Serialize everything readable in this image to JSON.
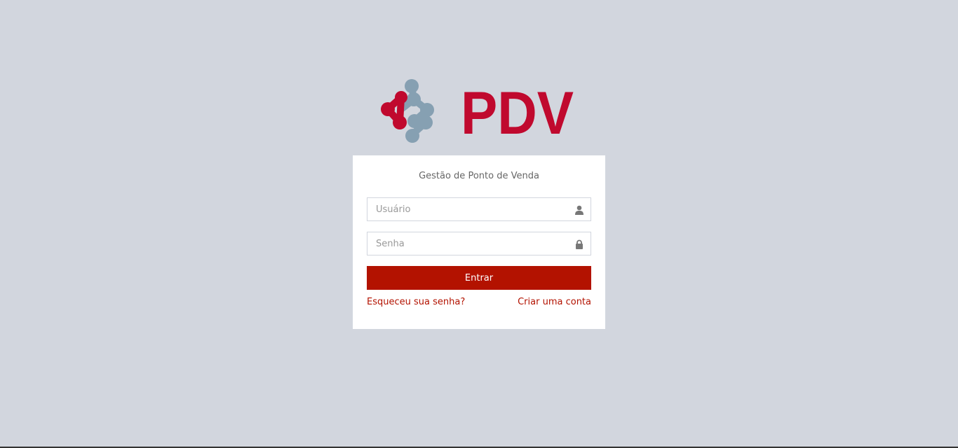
{
  "logo": {
    "text": "PDV",
    "icon": "molecule-logo-icon",
    "colors": {
      "primary": "#c0092e",
      "secondary": "#86a0b2"
    }
  },
  "login": {
    "message": "Gestão de Ponto de Venda",
    "username": {
      "placeholder": "Usuário",
      "value": "",
      "icon": "user-icon"
    },
    "password": {
      "placeholder": "Senha",
      "value": "",
      "icon": "lock-icon"
    },
    "submit_label": "Entrar",
    "forgot_label": "Esqueceu sua senha?",
    "register_label": "Criar uma conta"
  },
  "colors": {
    "background": "#d2d6de",
    "accent": "#b31200",
    "box": "#ffffff"
  }
}
